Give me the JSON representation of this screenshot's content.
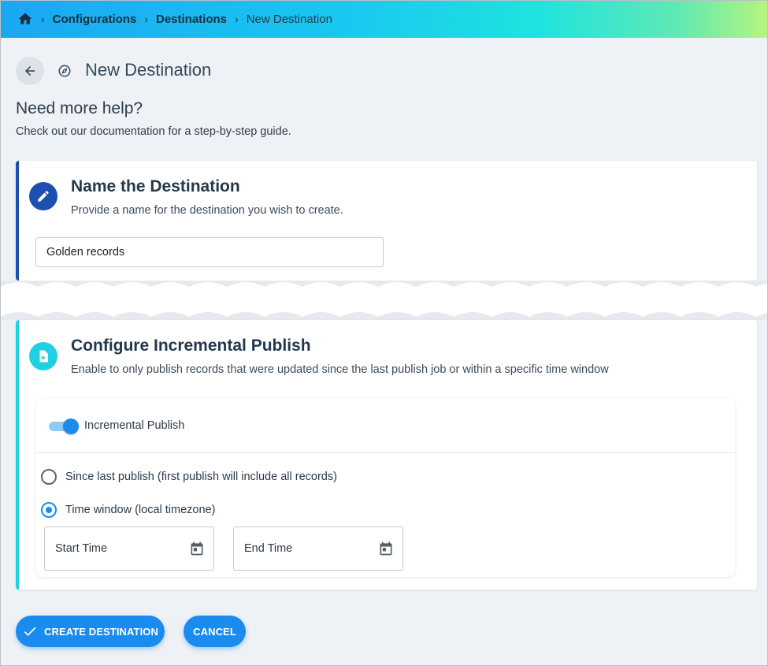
{
  "breadcrumb": {
    "items": [
      "Configurations",
      "Destinations"
    ],
    "current": "New Destination",
    "separator": "›"
  },
  "header": {
    "title": "New Destination"
  },
  "help": {
    "title": "Need more help?",
    "subtitle": "Check out our documentation for a step-by-step guide."
  },
  "name_section": {
    "title": "Name the Destination",
    "subtitle": "Provide a name for the destination you wish to create.",
    "input_value": "Golden records"
  },
  "incremental_section": {
    "title": "Configure Incremental Publish",
    "subtitle": "Enable to only publish records that were updated since the last publish job or within a specific time window",
    "toggle_label": "Incremental Publish",
    "toggle_on": true,
    "options": [
      {
        "label": "Since last publish (first publish will include all records)",
        "selected": false
      },
      {
        "label": "Time window (local timezone)",
        "selected": true
      }
    ],
    "start_time_label": "Start Time",
    "end_time_label": "End Time"
  },
  "actions": {
    "create_label": "CREATE DESTINATION",
    "cancel_label": "CANCEL"
  },
  "colors": {
    "accent": "#1a8cf0",
    "name_bar": "#1c4fb0",
    "incremental_bar": "#1fd0e3"
  }
}
